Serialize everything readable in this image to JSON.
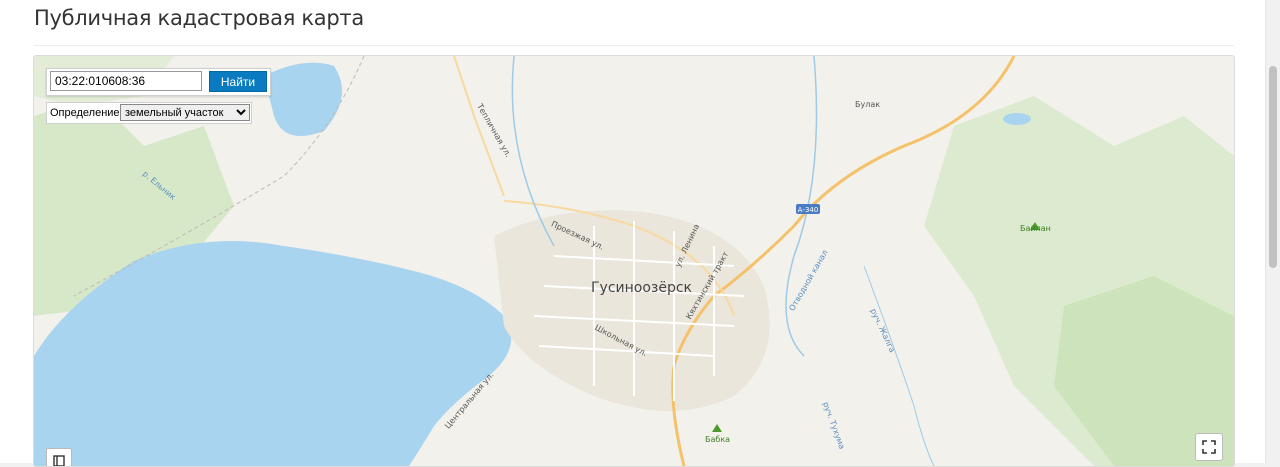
{
  "page": {
    "title": "Публичная кадастровая карта"
  },
  "search": {
    "value": "03:22:010608:36",
    "button_label": "Найти"
  },
  "definition": {
    "label": "Определение:",
    "selected": "земельный участок"
  },
  "map": {
    "city": "Гусиноозёрск",
    "road_badge": "А-340",
    "places": {
      "bulak": "Булак",
      "bailan": "Байлан",
      "babka": "Бабка"
    },
    "streets": {
      "teplichnaya": "Тепличная ул.",
      "proezzhaya": "Проезжая ул.",
      "lenina": "ул. Ленина",
      "kyakhtinsky": "Кяхтинский тракт",
      "shkolnaya": "Школьная ул.",
      "centralnaya": "Центральная ул.",
      "otvodnoy": "Отводной канал",
      "yelnik": "р. Ельник",
      "zhalga": "руч. Жалга",
      "tukhuma": "руч. Тухума"
    }
  }
}
